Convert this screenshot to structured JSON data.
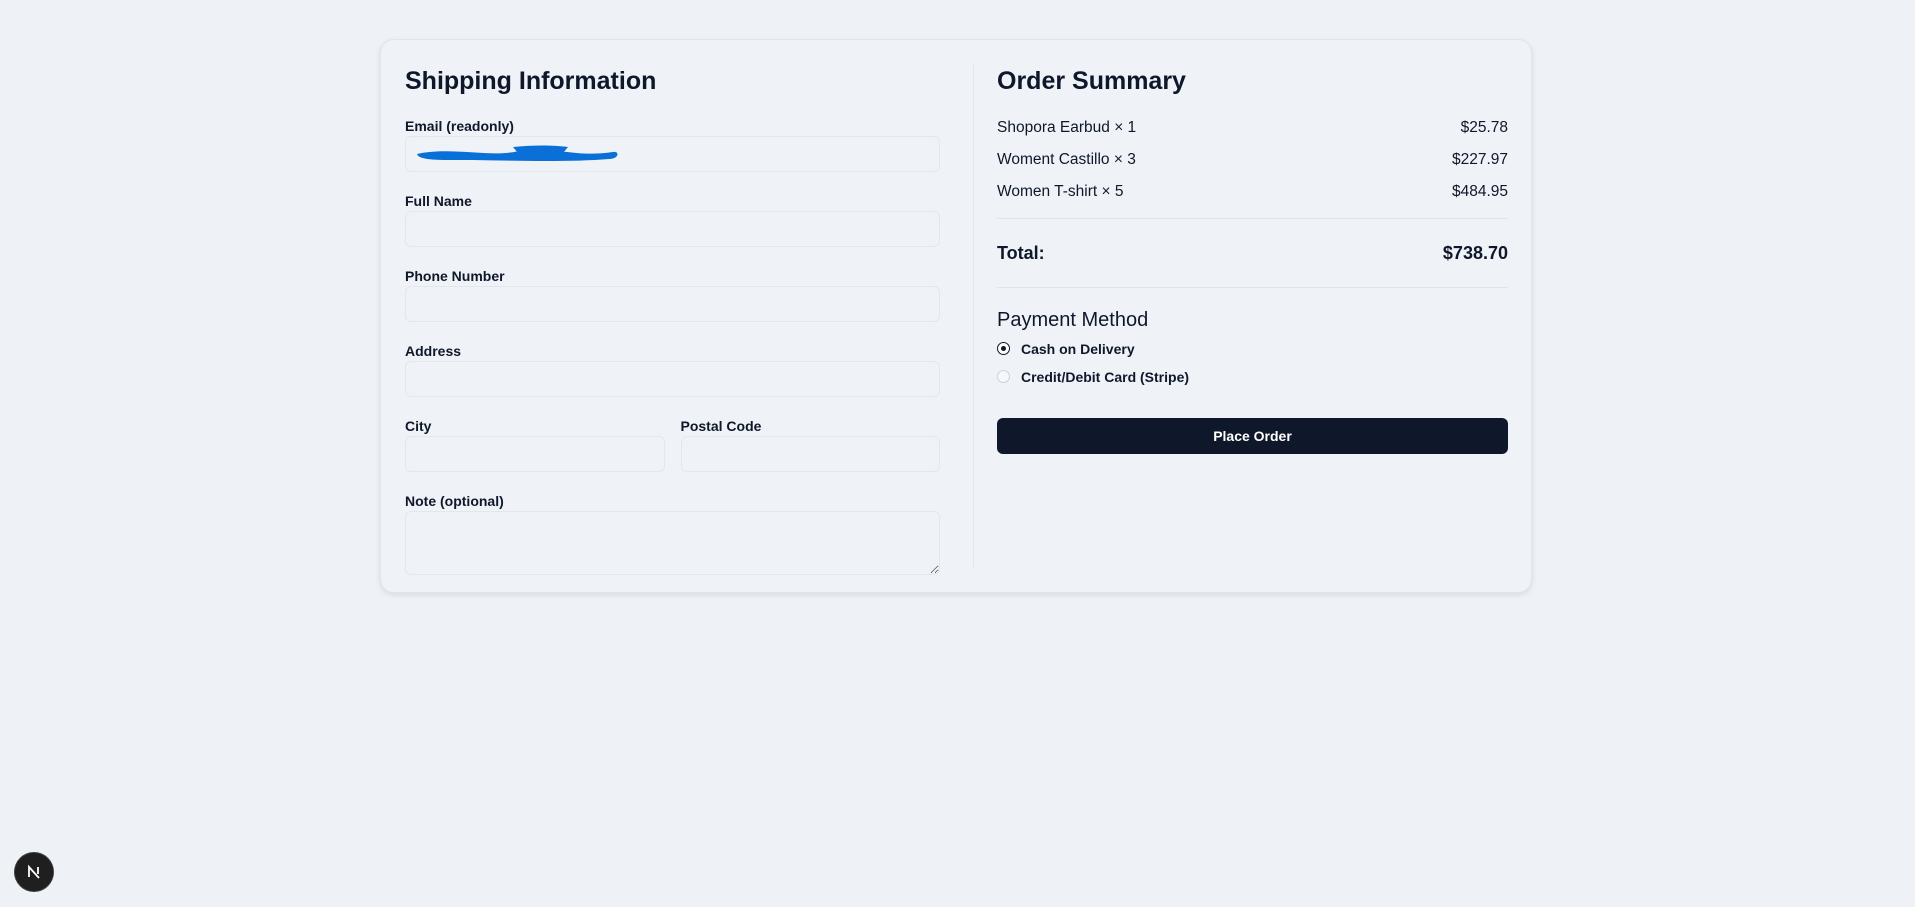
{
  "shipping": {
    "title": "Shipping Information",
    "email": {
      "label": "Email (readonly)",
      "value": ""
    },
    "full_name": {
      "label": "Full Name",
      "value": ""
    },
    "phone": {
      "label": "Phone Number",
      "value": ""
    },
    "address": {
      "label": "Address",
      "value": ""
    },
    "city": {
      "label": "City",
      "value": ""
    },
    "postal_code": {
      "label": "Postal Code",
      "value": ""
    },
    "note": {
      "label": "Note (optional)",
      "value": ""
    }
  },
  "summary": {
    "title": "Order Summary",
    "items": [
      {
        "name": "Shopora Earbud × 1",
        "price": "$25.78"
      },
      {
        "name": "Woment Castillo × 3",
        "price": "$227.97"
      },
      {
        "name": "Women T-shirt × 5",
        "price": "$484.95"
      }
    ],
    "total_label": "Total:",
    "total_value": "$738.70"
  },
  "payment": {
    "title": "Payment Method",
    "options": [
      {
        "label": "Cash on Delivery",
        "selected": true
      },
      {
        "label": "Credit/Debit Card (Stripe)",
        "selected": false
      }
    ]
  },
  "actions": {
    "place_order": "Place Order"
  },
  "colors": {
    "primary": "#0f172a",
    "redaction": "#0a6fd6",
    "background": "#eef2f7"
  },
  "icons": {
    "dev_badge": "nextjs-n-icon",
    "redaction": "redaction-scribble"
  }
}
